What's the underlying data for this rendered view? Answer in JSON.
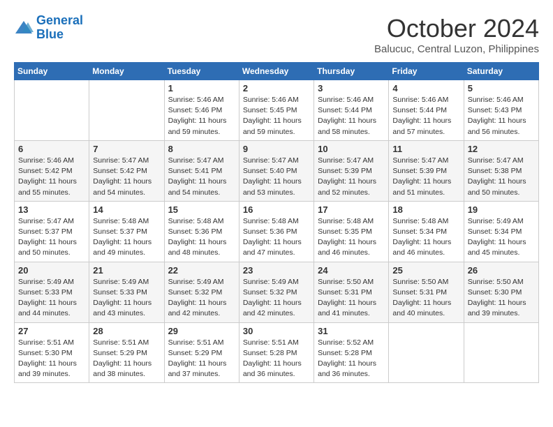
{
  "logo": {
    "line1": "General",
    "line2": "Blue"
  },
  "title": "October 2024",
  "subtitle": "Balucuc, Central Luzon, Philippines",
  "weekdays": [
    "Sunday",
    "Monday",
    "Tuesday",
    "Wednesday",
    "Thursday",
    "Friday",
    "Saturday"
  ],
  "weeks": [
    [
      {
        "day": "",
        "info": ""
      },
      {
        "day": "",
        "info": ""
      },
      {
        "day": "1",
        "info": "Sunrise: 5:46 AM\nSunset: 5:46 PM\nDaylight: 11 hours and 59 minutes."
      },
      {
        "day": "2",
        "info": "Sunrise: 5:46 AM\nSunset: 5:45 PM\nDaylight: 11 hours and 59 minutes."
      },
      {
        "day": "3",
        "info": "Sunrise: 5:46 AM\nSunset: 5:44 PM\nDaylight: 11 hours and 58 minutes."
      },
      {
        "day": "4",
        "info": "Sunrise: 5:46 AM\nSunset: 5:44 PM\nDaylight: 11 hours and 57 minutes."
      },
      {
        "day": "5",
        "info": "Sunrise: 5:46 AM\nSunset: 5:43 PM\nDaylight: 11 hours and 56 minutes."
      }
    ],
    [
      {
        "day": "6",
        "info": "Sunrise: 5:46 AM\nSunset: 5:42 PM\nDaylight: 11 hours and 55 minutes."
      },
      {
        "day": "7",
        "info": "Sunrise: 5:47 AM\nSunset: 5:42 PM\nDaylight: 11 hours and 54 minutes."
      },
      {
        "day": "8",
        "info": "Sunrise: 5:47 AM\nSunset: 5:41 PM\nDaylight: 11 hours and 54 minutes."
      },
      {
        "day": "9",
        "info": "Sunrise: 5:47 AM\nSunset: 5:40 PM\nDaylight: 11 hours and 53 minutes."
      },
      {
        "day": "10",
        "info": "Sunrise: 5:47 AM\nSunset: 5:39 PM\nDaylight: 11 hours and 52 minutes."
      },
      {
        "day": "11",
        "info": "Sunrise: 5:47 AM\nSunset: 5:39 PM\nDaylight: 11 hours and 51 minutes."
      },
      {
        "day": "12",
        "info": "Sunrise: 5:47 AM\nSunset: 5:38 PM\nDaylight: 11 hours and 50 minutes."
      }
    ],
    [
      {
        "day": "13",
        "info": "Sunrise: 5:47 AM\nSunset: 5:37 PM\nDaylight: 11 hours and 50 minutes."
      },
      {
        "day": "14",
        "info": "Sunrise: 5:48 AM\nSunset: 5:37 PM\nDaylight: 11 hours and 49 minutes."
      },
      {
        "day": "15",
        "info": "Sunrise: 5:48 AM\nSunset: 5:36 PM\nDaylight: 11 hours and 48 minutes."
      },
      {
        "day": "16",
        "info": "Sunrise: 5:48 AM\nSunset: 5:36 PM\nDaylight: 11 hours and 47 minutes."
      },
      {
        "day": "17",
        "info": "Sunrise: 5:48 AM\nSunset: 5:35 PM\nDaylight: 11 hours and 46 minutes."
      },
      {
        "day": "18",
        "info": "Sunrise: 5:48 AM\nSunset: 5:34 PM\nDaylight: 11 hours and 46 minutes."
      },
      {
        "day": "19",
        "info": "Sunrise: 5:49 AM\nSunset: 5:34 PM\nDaylight: 11 hours and 45 minutes."
      }
    ],
    [
      {
        "day": "20",
        "info": "Sunrise: 5:49 AM\nSunset: 5:33 PM\nDaylight: 11 hours and 44 minutes."
      },
      {
        "day": "21",
        "info": "Sunrise: 5:49 AM\nSunset: 5:33 PM\nDaylight: 11 hours and 43 minutes."
      },
      {
        "day": "22",
        "info": "Sunrise: 5:49 AM\nSunset: 5:32 PM\nDaylight: 11 hours and 42 minutes."
      },
      {
        "day": "23",
        "info": "Sunrise: 5:49 AM\nSunset: 5:32 PM\nDaylight: 11 hours and 42 minutes."
      },
      {
        "day": "24",
        "info": "Sunrise: 5:50 AM\nSunset: 5:31 PM\nDaylight: 11 hours and 41 minutes."
      },
      {
        "day": "25",
        "info": "Sunrise: 5:50 AM\nSunset: 5:31 PM\nDaylight: 11 hours and 40 minutes."
      },
      {
        "day": "26",
        "info": "Sunrise: 5:50 AM\nSunset: 5:30 PM\nDaylight: 11 hours and 39 minutes."
      }
    ],
    [
      {
        "day": "27",
        "info": "Sunrise: 5:51 AM\nSunset: 5:30 PM\nDaylight: 11 hours and 39 minutes."
      },
      {
        "day": "28",
        "info": "Sunrise: 5:51 AM\nSunset: 5:29 PM\nDaylight: 11 hours and 38 minutes."
      },
      {
        "day": "29",
        "info": "Sunrise: 5:51 AM\nSunset: 5:29 PM\nDaylight: 11 hours and 37 minutes."
      },
      {
        "day": "30",
        "info": "Sunrise: 5:51 AM\nSunset: 5:28 PM\nDaylight: 11 hours and 36 minutes."
      },
      {
        "day": "31",
        "info": "Sunrise: 5:52 AM\nSunset: 5:28 PM\nDaylight: 11 hours and 36 minutes."
      },
      {
        "day": "",
        "info": ""
      },
      {
        "day": "",
        "info": ""
      }
    ]
  ]
}
